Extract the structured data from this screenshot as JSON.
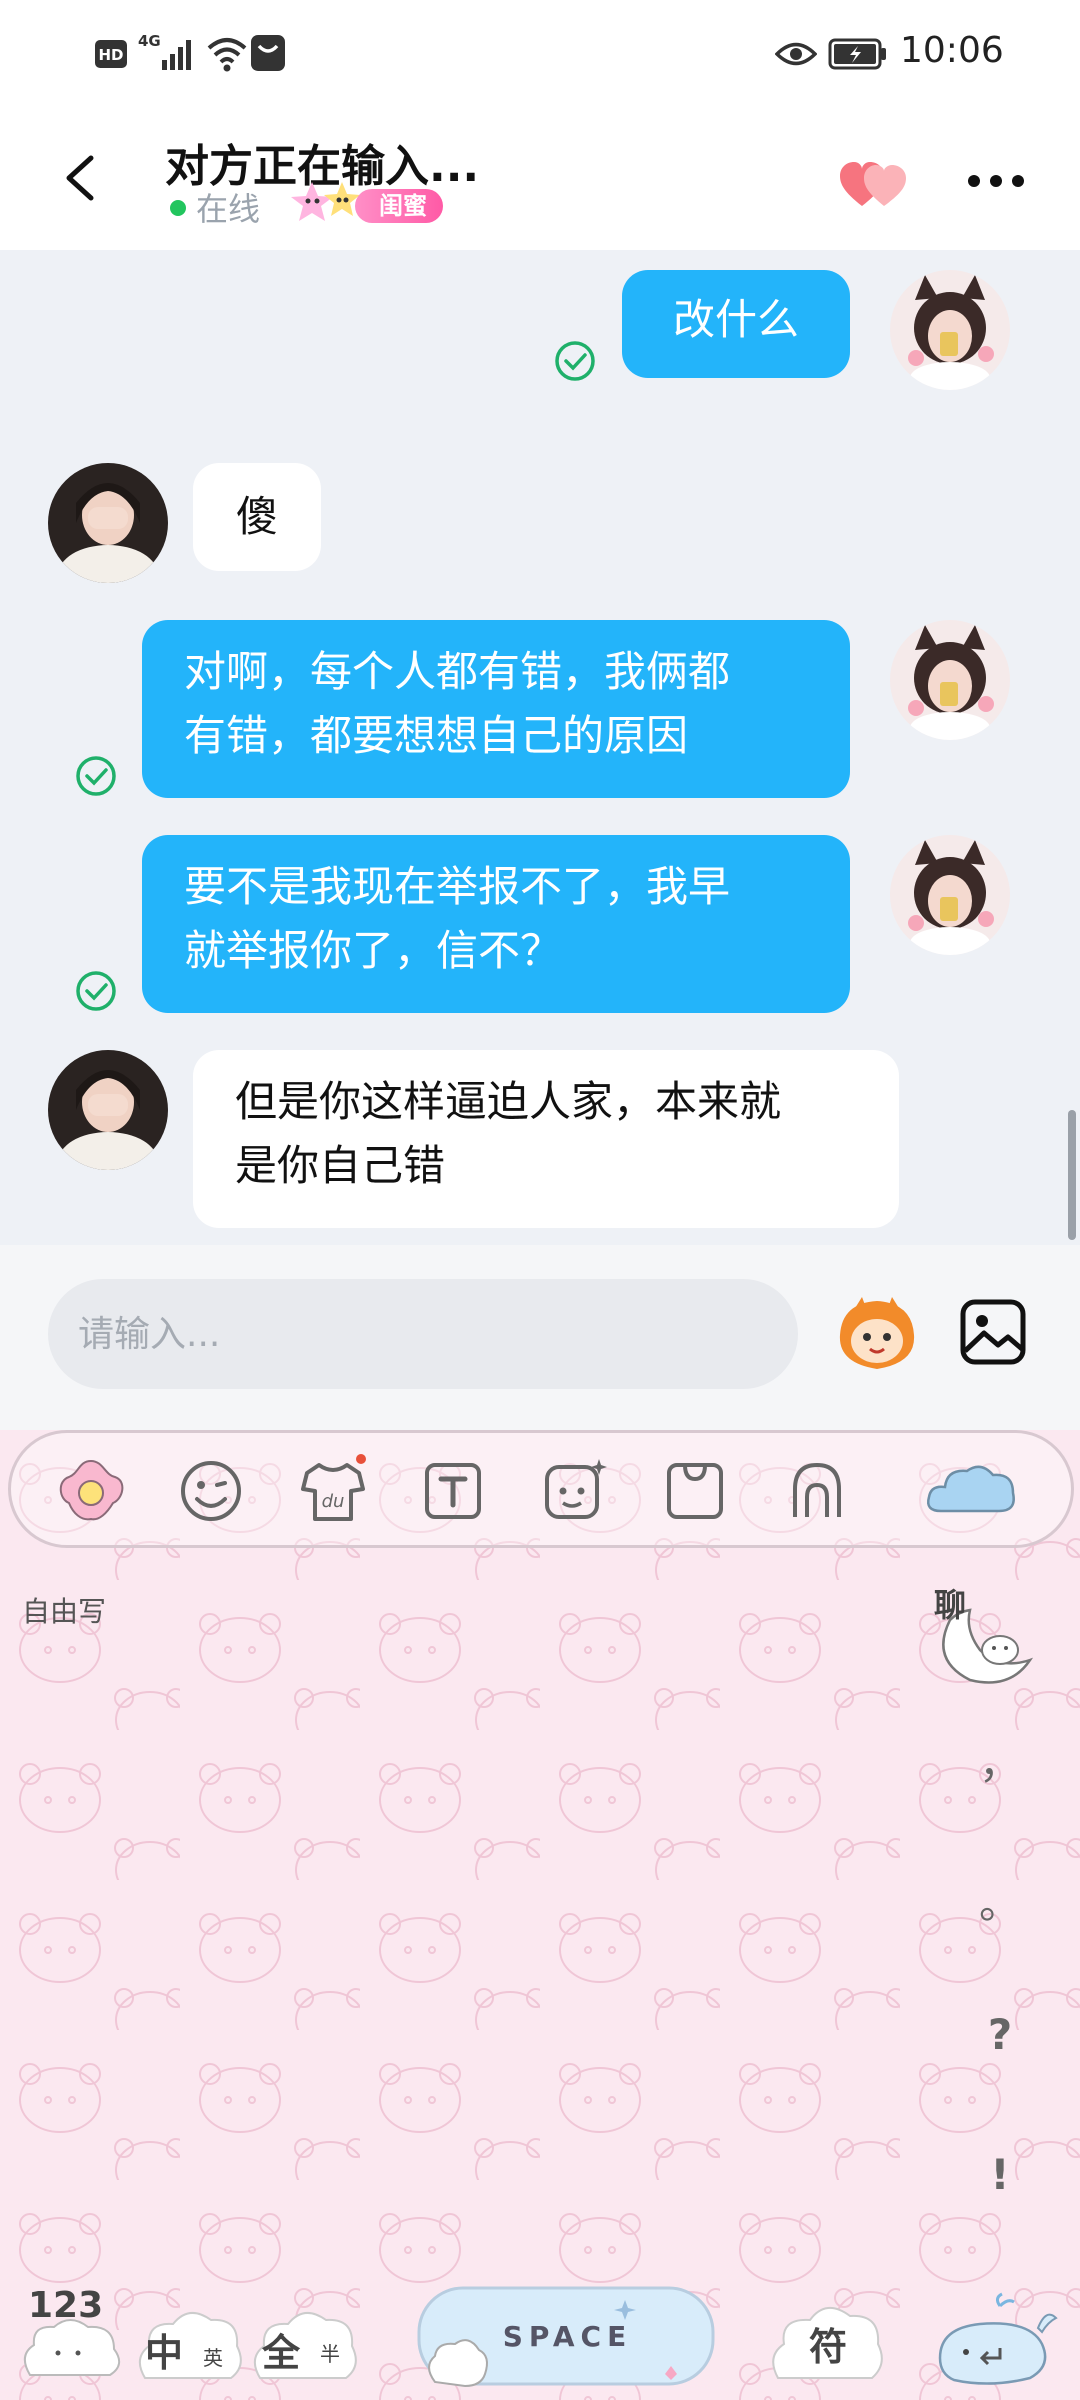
{
  "status_bar": {
    "left_icons": [
      "hd-icon",
      "4g-signal-icon",
      "wifi-icon",
      "notification-app-icon"
    ],
    "hd": "HD",
    "network": "4G",
    "time": "10:06"
  },
  "header": {
    "title": "对方正在输入...",
    "status": "在线",
    "badge": "闺蜜"
  },
  "messages": [
    {
      "side": "me",
      "text": "改什么",
      "delivered": true
    },
    {
      "side": "them",
      "text": "傻"
    },
    {
      "side": "me",
      "lines": [
        "对啊，每个人都有错，我俩都",
        "有错，都要想想自己的原因"
      ],
      "delivered": true
    },
    {
      "side": "me",
      "lines": [
        "要不是我现在举报不了，我早",
        "就举报你了，信不？"
      ],
      "delivered": true
    },
    {
      "side": "them",
      "lines": [
        "但是你这样逼迫人家，本来就",
        "是你自己错"
      ]
    }
  ],
  "input": {
    "placeholder": "请输入..."
  },
  "keyboard": {
    "toolbar_icons": [
      "flower-icon",
      "emoji-icon",
      "shirt-icon",
      "text-icon",
      "sticker-icon",
      "clipboard-icon",
      "handwriting-icon",
      "cloud-icon"
    ],
    "free_write": "自由写",
    "chat_key": "聊",
    "punctuation": [
      "，",
      "。",
      "?",
      "!"
    ],
    "bottom_keys": {
      "numbers": "123",
      "lang_zh": "中",
      "lang_en": "英",
      "width_full": "全",
      "width_half": "半",
      "space": "SPACE",
      "symbols": "符"
    }
  }
}
